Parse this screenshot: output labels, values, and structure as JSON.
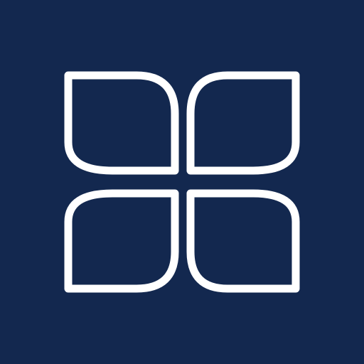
{
  "app_icon": {
    "icon_name": "four-petal-quatrefoil-icon",
    "colors": {
      "background": "#13284f",
      "stroke": "#ffffff"
    }
  }
}
